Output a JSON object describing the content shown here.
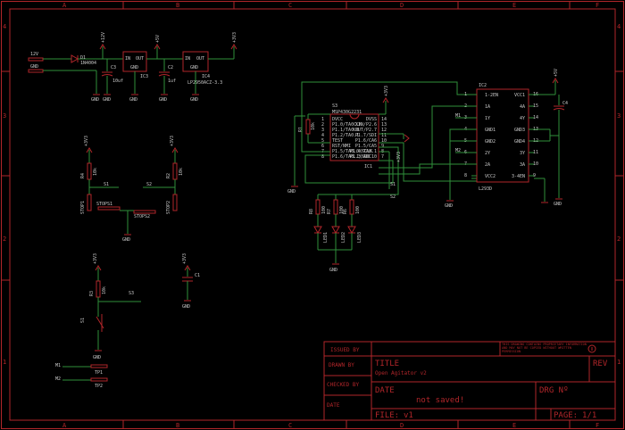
{
  "ruler": {
    "cols": [
      "A",
      "B",
      "C",
      "D",
      "E",
      "F"
    ],
    "rows": [
      "4",
      "3",
      "2",
      "1"
    ]
  },
  "title_block": {
    "issued_by": "ISSUED BY",
    "drawn_by": "DRAWN BY",
    "checked_by": "CHECKED BY",
    "date_small": "DATE",
    "title_label": "TITLE",
    "title_value": "Open Agitator v2",
    "date_label": "DATE",
    "date_value": "not saved!",
    "drg_label": "DRG Nº",
    "rev_label": "REV",
    "file_label": "FILE:",
    "file_value": "v1",
    "page_label": "PAGE:",
    "page_value": "1/1",
    "notice": "THIS DRAWING CONTAINS PROPRIETARY INFORMATION AND MAY NOT BE COPIED WITHOUT WRITTEN PERMISSION"
  },
  "power": {
    "v12": "+12V",
    "v5": "+5V",
    "v33": "+3V3",
    "gnd": "GND",
    "in12": "12V",
    "in_gnd": "GND"
  },
  "parts": {
    "d1_name": "D1",
    "d1_value": "1N4004",
    "c3_name": "C3",
    "c3_value": "10uf",
    "ic3_name": "IC3",
    "ic3_in": "IN",
    "ic3_out": "OUT",
    "ic3_gnd": "GND",
    "c2_name": "C2",
    "c2_value": "1uf",
    "ic4_name": "IC4",
    "ic4_value": "LP2950ACZ-3.3",
    "r4_name": "R4",
    "r4_value": "10k",
    "r2_name": "R2",
    "r2_value": "10k",
    "s1_net": "S1",
    "s2_net": "S2",
    "stop1": "STOP1",
    "stop2": "STOP2",
    "stops1": "STOPS1",
    "stops2": "STOPS2",
    "r3_name": "R3",
    "r3_value": "10k",
    "s3_net": "S3",
    "sw_name": "S1",
    "c1_name": "C1",
    "tp1": "TP1",
    "tp2": "TP2",
    "m1": "M1",
    "m2": "M2",
    "msp_name": "S3",
    "msp_value": "MSP430G2231",
    "ic1_name": "IC1",
    "r1_name": "R1",
    "r1_value": "10k",
    "r8_name": "R8",
    "r8_value": "100",
    "r7_name": "R7",
    "r7_value": "100",
    "r6_name": "R6",
    "r6_value": "100",
    "r5_name": "R5",
    "r5_value": "100",
    "led1": "LED1",
    "led2": "LED2",
    "led3": "LED3",
    "ic2_name": "IC2",
    "ic2_value": "L293D",
    "c4_name": "C4",
    "msp_pins_left": [
      "DVCC",
      "P1.0/TA0CLK",
      "P1.1/TA0.0",
      "P1.2/TA0.1",
      "TEST",
      "RST/NMI",
      "P1.5/TA0.0/SCLK",
      "P1.6/TA0.1/SDO"
    ],
    "msp_pins_right": [
      "DVSS",
      "XIN/P2.6",
      "XOUT/P2.7",
      "P1.7/SDI",
      "P1.6/CA6",
      "P1.5/CA5",
      "P1.4/TA0.1",
      "P1.3/ADC10"
    ],
    "l293_left": [
      "1-2EN",
      "1A",
      "1Y",
      "GND1",
      "GND2",
      "2Y",
      "2A",
      "VCC2"
    ],
    "l293_right": [
      "VCC1",
      "4A",
      "4Y",
      "GND3",
      "GND4",
      "3Y",
      "3A",
      "3-4EN"
    ],
    "l293_left_num": [
      "1",
      "2",
      "3",
      "4",
      "5",
      "6",
      "7",
      "8"
    ],
    "l293_right_num": [
      "16",
      "15",
      "14",
      "13",
      "12",
      "11",
      "10",
      "9"
    ],
    "msp_left_num": [
      "1",
      "2",
      "3",
      "4",
      "5",
      "6",
      "7",
      "8"
    ],
    "msp_right_num": [
      "14",
      "13",
      "12",
      "11",
      "10",
      "9",
      "8",
      "7"
    ]
  }
}
